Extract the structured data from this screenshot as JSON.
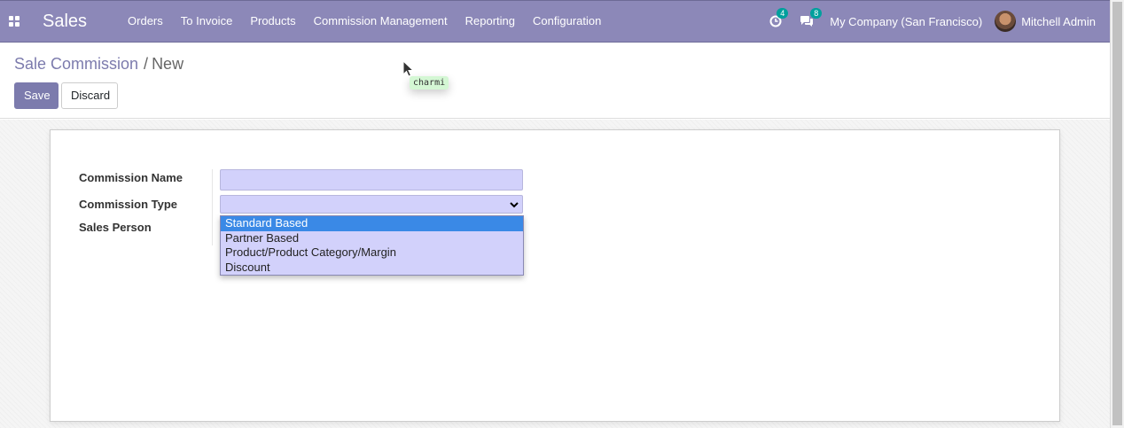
{
  "navbar": {
    "app_name": "Sales",
    "menu": [
      "Orders",
      "To Invoice",
      "Products",
      "Commission Management",
      "Reporting",
      "Configuration"
    ],
    "activity_count": "4",
    "message_count": "8",
    "company": "My Company (San Francisco)",
    "user": "Mitchell Admin",
    "color": "#8c88b8"
  },
  "breadcrumb": {
    "parent": "Sale Commission",
    "current": "New"
  },
  "buttons": {
    "save": "Save",
    "discard": "Discard"
  },
  "cursor_tooltip": "charmi",
  "form": {
    "commission_name_label": "Commission Name",
    "commission_name_value": "",
    "commission_type_label": "Commission Type",
    "commission_type_value": "",
    "sales_person_label": "Sales Person",
    "commission_type_options": [
      "Standard Based",
      "Partner Based",
      "Product/Product Category/Margin",
      "Discount"
    ],
    "highlighted_option": "Standard Based"
  },
  "colors": {
    "accent": "#7c7bad",
    "field_bg": "#d2d1fb",
    "option_highlight": "#3a89e6"
  }
}
